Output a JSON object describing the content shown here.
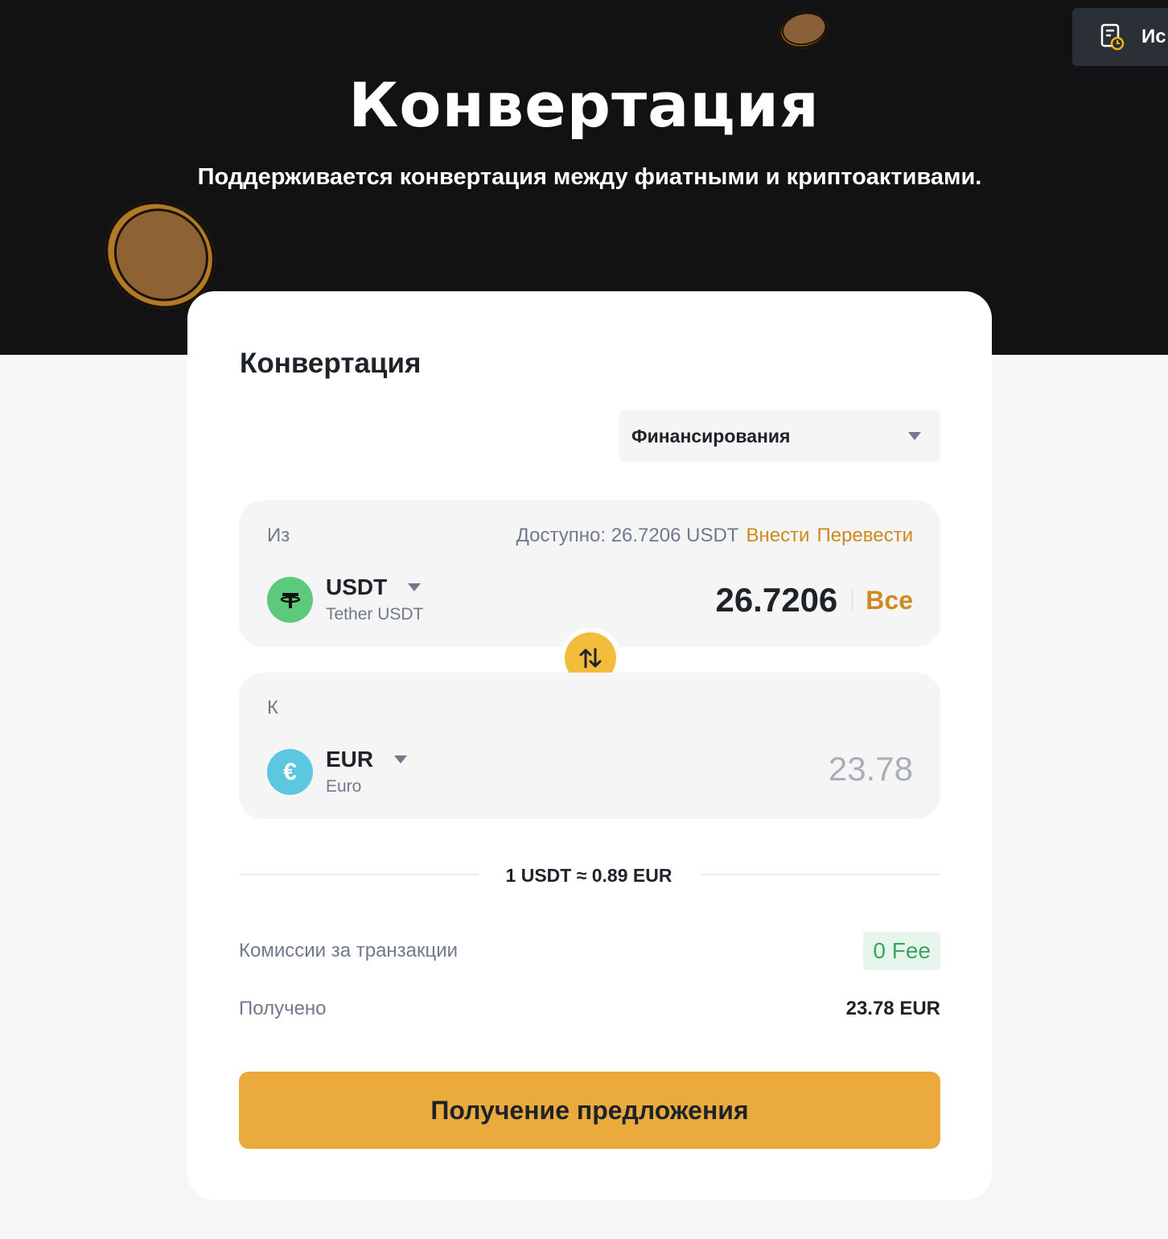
{
  "hero": {
    "title": "Конвертация",
    "subtitle": "Поддерживается конвертация между фиатными и криптоактивами."
  },
  "header": {
    "history_label": "Ис",
    "history_icon": "history-document-clock-icon"
  },
  "card": {
    "title": "Конвертация",
    "wallet_select": {
      "value": "Финансирования",
      "icon": "chevron-down-icon"
    },
    "from": {
      "label": "Из",
      "available_label": "Доступно: 26.7206 USDT",
      "deposit_link": "Внести",
      "transfer_link": "Перевести",
      "asset_code": "USDT",
      "asset_name": "Tether USDT",
      "asset_icon": "tether-icon",
      "asset_color": "#5cc97b",
      "amount": "26.7206",
      "all_label": "Все"
    },
    "swap_icon": "swap-arrows-icon",
    "to": {
      "label": "К",
      "asset_code": "EUR",
      "asset_name": "Euro",
      "asset_icon": "euro-icon",
      "asset_symbol": "€",
      "asset_color": "#5bc8e0",
      "amount": "23.78"
    },
    "rate": "1 USDT ≈ 0.89 EUR",
    "fee_label": "Комиссии за транзакции",
    "fee_value": "0 Fee",
    "received_label": "Получено",
    "received_value": "23.78 EUR",
    "cta_label": "Получение предложения"
  },
  "colors": {
    "accent": "#ebaa3c",
    "link": "#cf8a1f",
    "fee_green": "#37a65e",
    "hero_bg": "#121214"
  }
}
